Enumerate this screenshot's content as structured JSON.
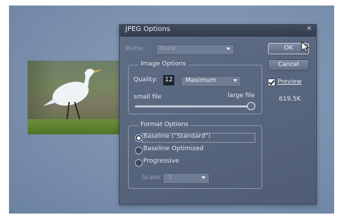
{
  "dialog": {
    "title": "JPEG Options",
    "close_symbol": "×",
    "matte_label": "Matte:",
    "matte_value": "None",
    "image_options": {
      "title": "Image Options",
      "quality_label": "Quality:",
      "quality_value": "12",
      "quality_preset": "Maximum",
      "small_file_label": "small file",
      "large_file_label": "large file",
      "quality_fraction": 1.0
    },
    "format_options": {
      "title": "Format Options",
      "options": [
        "Baseline (\"Standard\")",
        "Baseline Optimized",
        "Progressive"
      ],
      "selected_index": 0,
      "scans_label": "Scans:",
      "scans_value": "3"
    },
    "buttons": {
      "ok": "OK",
      "cancel": "Cancel"
    },
    "preview_label": "Preview",
    "preview_checked": true,
    "file_size": "619.5K"
  },
  "colors": {
    "dialog_bg": "#56647c",
    "titlebar_bg": "#3a4355",
    "desktop_bg": "#7d93b0"
  }
}
